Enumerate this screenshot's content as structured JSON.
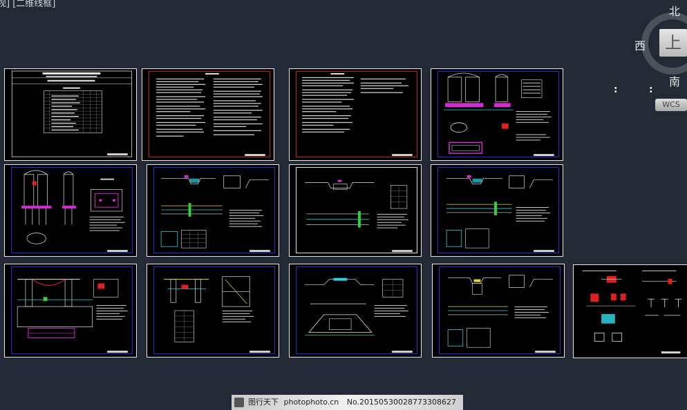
{
  "viewport": {
    "label": "视] [二维线框]"
  },
  "viewcube": {
    "face": "上",
    "north": "北",
    "south": "南",
    "west": "西",
    "wcs": "WCS"
  },
  "watermark": {
    "brand": "图行天下",
    "site": "photophoto.cn",
    "number": "No.20150530028773308627"
  },
  "colors": {
    "background": "#232a35",
    "sheet_border": "#e8e8e8",
    "frame_blue": "#2330d0",
    "frame_red": "#c81d1d",
    "cad_magenta": "#d62ad6",
    "cad_cyan": "#2fd3e0",
    "cad_yellow": "#e8e02a",
    "cad_red": "#e02020",
    "cad_green": "#30d040"
  },
  "sheets": [
    {
      "id": "s1",
      "kind": "cover",
      "frame": "none"
    },
    {
      "id": "s2",
      "kind": "notes",
      "frame": "red"
    },
    {
      "id": "s3",
      "kind": "notes",
      "frame": "red"
    },
    {
      "id": "s4",
      "kind": "tower-detail",
      "frame": "blue"
    },
    {
      "id": "s5",
      "kind": "tower-detail",
      "frame": "blue"
    },
    {
      "id": "s6",
      "kind": "plan-profile",
      "frame": "blue"
    },
    {
      "id": "s7",
      "kind": "plan-profile",
      "frame": "none"
    },
    {
      "id": "s8",
      "kind": "plan-profile",
      "frame": "blue"
    },
    {
      "id": "s9",
      "kind": "bridge-elevation",
      "frame": "blue"
    },
    {
      "id": "s10",
      "kind": "section-detail",
      "frame": "blue"
    },
    {
      "id": "s11",
      "kind": "embankment",
      "frame": "blue"
    },
    {
      "id": "s12",
      "kind": "plan-profile",
      "frame": "blue"
    },
    {
      "id": "s13",
      "kind": "details",
      "frame": "none"
    }
  ]
}
